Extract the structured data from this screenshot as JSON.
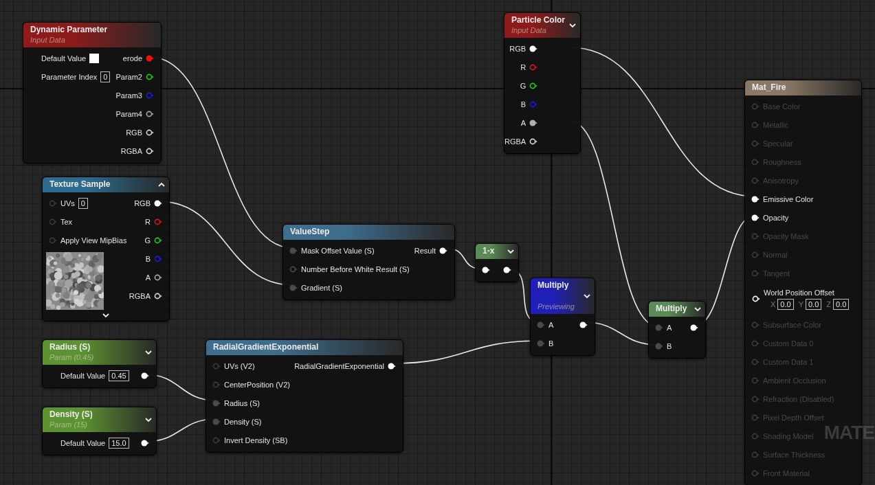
{
  "nodes": [
    {
      "title": "Particle Color",
      "subtitle": "Input Data",
      "color": "#8e1b1b",
      "expanded": false,
      "outputs": [
        {
          "label": "RGB",
          "color": "#ffffff",
          "connected": true
        },
        {
          "label": "R",
          "color": "#e01515",
          "connected": false
        },
        {
          "label": "G",
          "color": "#18d018",
          "connected": false
        },
        {
          "label": "B",
          "color": "#1a1ae8",
          "connected": false
        },
        {
          "label": "A",
          "color": "#b0b0b0",
          "connected": true
        },
        {
          "label": "RGBA",
          "color": "#d8d8d8",
          "connected": false
        }
      ]
    },
    {
      "title": "Dynamic Parameter",
      "subtitle": "Input Data",
      "color": "#8e1b1b",
      "properties": [
        {
          "kind": "swatch",
          "label": "Default Value",
          "color": "#ffffff"
        },
        {
          "kind": "number",
          "label": "Parameter Index",
          "value": "0"
        }
      ],
      "outputs": [
        {
          "label": "erode",
          "color": "#ee1111",
          "connected": true
        },
        {
          "label": "Param2",
          "color": "#18d018",
          "connected": false
        },
        {
          "label": "Param3",
          "color": "#1a1ae8",
          "connected": false
        },
        {
          "label": "Param4",
          "color": "#a8a8a8",
          "connected": false
        },
        {
          "label": "RGB",
          "color": "#d8d8d8",
          "connected": false
        },
        {
          "label": "RGBA",
          "color": "#d8d8d8",
          "connected": false
        }
      ]
    },
    {
      "title": "Mat_Fire",
      "color": "#8a7866",
      "inputs": [
        {
          "label": "Base Color",
          "color": "#3c3c3c",
          "connected": false,
          "disabled": true
        },
        {
          "label": "Metallic",
          "color": "#3c3c3c",
          "connected": false,
          "disabled": true
        },
        {
          "label": "Specular",
          "color": "#3c3c3c",
          "connected": false,
          "disabled": true
        },
        {
          "label": "Roughness",
          "color": "#3c3c3c",
          "connected": false,
          "disabled": true
        },
        {
          "label": "Anisotropy",
          "color": "#3c3c3c",
          "connected": false,
          "disabled": true
        },
        {
          "label": "Emissive Color",
          "color": "#ffffff",
          "connected": true,
          "disabled": false
        },
        {
          "label": "Opacity",
          "color": "#ffffff",
          "connected": true,
          "disabled": false
        },
        {
          "label": "Opacity Mask",
          "color": "#3c3c3c",
          "connected": false,
          "disabled": true
        },
        {
          "label": "Normal",
          "color": "#3c3c3c",
          "connected": false,
          "disabled": true
        },
        {
          "label": "Tangent",
          "color": "#3c3c3c",
          "connected": false,
          "disabled": true
        },
        {
          "label": "World Position Offset",
          "color": "#ffffff",
          "connected": false,
          "disabled": false,
          "fields": [
            {
              "axis": "X",
              "value": "0.0"
            },
            {
              "axis": "Y",
              "value": "0.0"
            },
            {
              "axis": "Z",
              "value": "0.0"
            }
          ]
        },
        {
          "label": "Subsurface Color",
          "color": "#3c3c3c",
          "connected": false,
          "disabled": true
        },
        {
          "label": "Custom Data 0",
          "color": "#3c3c3c",
          "connected": false,
          "disabled": true
        },
        {
          "label": "Custom Data 1",
          "color": "#3c3c3c",
          "connected": false,
          "disabled": true
        },
        {
          "label": "Ambient Occlusion",
          "color": "#3c3c3c",
          "connected": false,
          "disabled": true
        },
        {
          "label": "Refraction (Disabled)",
          "color": "#3c3c3c",
          "connected": false,
          "disabled": true
        },
        {
          "label": "Pixel Depth Offset",
          "color": "#3c3c3c",
          "connected": false,
          "disabled": true
        },
        {
          "label": "Shading Model",
          "color": "#3c3c3c",
          "connected": false,
          "disabled": true
        },
        {
          "label": "Surface Thickness",
          "color": "#3c3c3c",
          "connected": false,
          "disabled": true
        },
        {
          "label": "Front Material",
          "color": "#3c3c3c",
          "connected": false,
          "disabled": true
        }
      ]
    },
    {
      "title": "Texture Sample",
      "color": "#2d6a8c",
      "expanded": true,
      "advanced_shown": false,
      "texture_preview": true,
      "inputs": [
        {
          "label": "UVs",
          "color": "#3a3a3a",
          "connected": false,
          "value": "0"
        },
        {
          "label": "Tex",
          "color": "#3a3a3a",
          "connected": false
        },
        {
          "label": "Apply View MipBias",
          "color": "#3a3a3a",
          "connected": false
        }
      ],
      "outputs": [
        {
          "label": "RGB",
          "color": "#ffffff",
          "connected": true
        },
        {
          "label": "R",
          "color": "#e01515",
          "connected": false
        },
        {
          "label": "G",
          "color": "#18d018",
          "connected": false
        },
        {
          "label": "B",
          "color": "#1a1ae8",
          "connected": false
        },
        {
          "label": "A",
          "color": "#a8a8a8",
          "connected": false
        },
        {
          "label": "RGBA",
          "color": "#d8d8d8",
          "connected": false
        }
      ]
    },
    {
      "title": "ValueStep",
      "color": "#3f6d8e",
      "inputs": [
        {
          "label": "Mask Offset Value (S)",
          "color": "#4a4a4a",
          "connected": true
        },
        {
          "label": "Number Before White Result (S)",
          "color": "#4a4a4a",
          "connected": false
        },
        {
          "label": "Gradient (S)",
          "color": "#4a4a4a",
          "connected": true
        }
      ],
      "outputs": [
        {
          "label": "Result",
          "color": "#ffffff",
          "connected": true
        }
      ]
    },
    {
      "title": "1-x",
      "color": "#5a8a55",
      "expanded": false,
      "inputs": [
        {
          "color": "#ffffff",
          "connected": true
        }
      ],
      "outputs": [
        {
          "color": "#ffffff",
          "connected": true
        }
      ]
    },
    {
      "title": "Multiply",
      "subtitle": "Previewing",
      "color": "#2020b8",
      "expanded": false,
      "inputs": [
        {
          "label": "A",
          "color": "#4a4a4a",
          "connected": true
        },
        {
          "label": "B",
          "color": "#4a4a4a",
          "connected": true
        }
      ],
      "outputs": [
        {
          "color": "#ffffff",
          "connected": true
        }
      ]
    },
    {
      "title": "Multiply",
      "color": "#5a8a55",
      "expanded": false,
      "inputs": [
        {
          "label": "A",
          "color": "#4a4a4a",
          "connected": true
        },
        {
          "label": "B",
          "color": "#4a4a4a",
          "connected": true
        }
      ],
      "outputs": [
        {
          "color": "#ffffff",
          "connected": true
        }
      ]
    },
    {
      "title": "Radius (S)",
      "subtitle": "Param (0.45)",
      "color": "#5c9232",
      "expanded": false,
      "properties": [
        {
          "kind": "number",
          "label": "Default Value",
          "value": "0.45"
        }
      ],
      "outputs": [
        {
          "color": "#ffffff",
          "connected": true
        }
      ]
    },
    {
      "title": "Density (S)",
      "subtitle": "Param (15)",
      "color": "#5c9232",
      "expanded": false,
      "properties": [
        {
          "kind": "number",
          "label": "Default Value",
          "value": "15.0"
        }
      ],
      "outputs": [
        {
          "color": "#ffffff",
          "connected": true
        }
      ]
    },
    {
      "title": "RadialGradientExponential",
      "color": "#3f6d8e",
      "inputs": [
        {
          "label": "UVs (V2)",
          "color": "#3a3a3a",
          "connected": false
        },
        {
          "label": "CenterPosition (V2)",
          "color": "#3a3a3a",
          "connected": false
        },
        {
          "label": "Radius (S)",
          "color": "#4a4a4a",
          "connected": true
        },
        {
          "label": "Density (S)",
          "color": "#4a4a4a",
          "connected": true
        },
        {
          "label": "Invert Density (SB)",
          "color": "#3a3a3a",
          "connected": false
        }
      ],
      "outputs": [
        {
          "label": "RadialGradientExponential",
          "color": "#ffffff",
          "connected": true
        }
      ]
    }
  ],
  "corner_label": "MATE"
}
